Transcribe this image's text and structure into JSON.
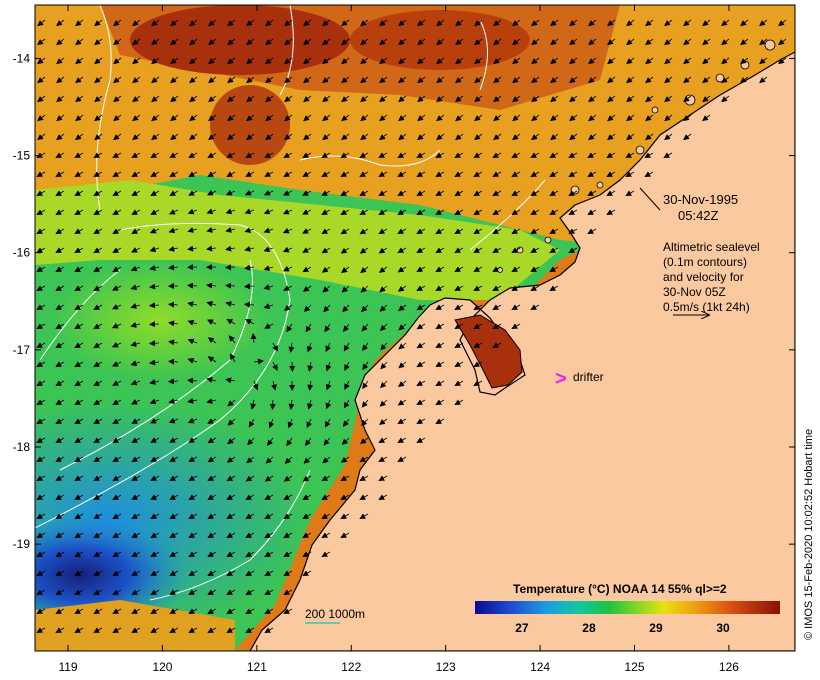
{
  "map": {
    "lon_ticks": [
      "119",
      "120",
      "121",
      "122",
      "123",
      "124",
      "125",
      "126"
    ],
    "lat_ticks": [
      "-14",
      "-15",
      "-16",
      "-17",
      "-18",
      "-19"
    ],
    "lon_range": [
      118.65,
      126.7
    ],
    "lat_range": [
      -20.1,
      -13.45
    ]
  },
  "annotation": {
    "date": "30-Nov-1995",
    "time": "05:42Z",
    "sealevel_lines": [
      "Altimetric sealevel",
      "(0.1m contours)",
      "and velocity for",
      "30-Nov 05Z",
      "0.5m/s (1kt 24h)"
    ]
  },
  "legend": {
    "drifter_symbol": ">",
    "drifter_label": "drifter",
    "depth_contours": "200  1000m"
  },
  "colorbar": {
    "title": "Temperature (°C) NOAA 14 55% ql>=2",
    "range": [
      26.3,
      30.85
    ],
    "labels": [
      "27",
      "28",
      "29",
      "30"
    ]
  },
  "credit": "© IMOS 15-Feb-2020 10:02:52 Hobart time",
  "colors": {
    "land": "#fbc9a0",
    "coast": "#000000",
    "arrow": "#000000",
    "drifter": "#ee22ee",
    "contour": "#ffffff",
    "depth200": "#33ccaa"
  }
}
